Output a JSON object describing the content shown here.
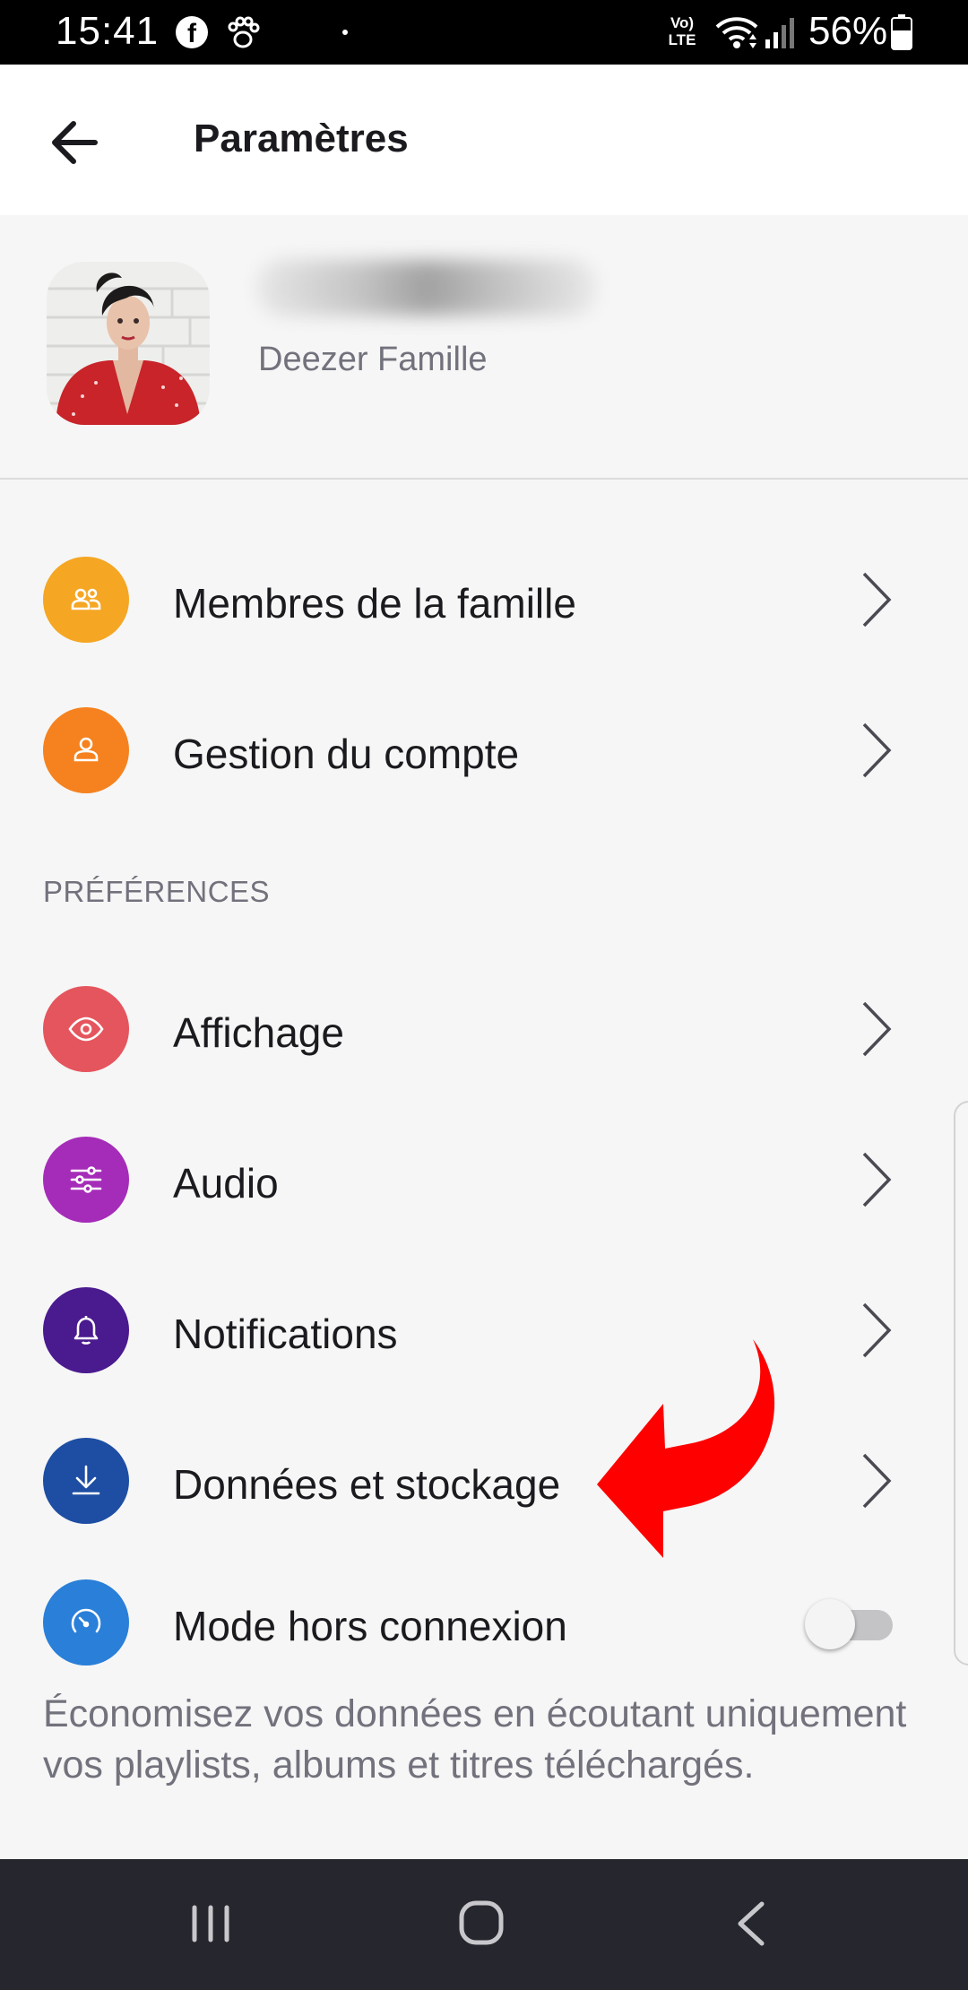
{
  "status_bar": {
    "time": "15:41",
    "facebook_glyph": "f",
    "volte_line1": "Vo)",
    "volte_line2": "LTE",
    "battery": "56%",
    "icons": [
      "facebook-icon",
      "paw-icon",
      "volte-icon",
      "wifi-icon",
      "signal-icon",
      "battery-icon"
    ]
  },
  "header": {
    "title": "Paramètres",
    "back_icon": "arrow-left-icon"
  },
  "profile": {
    "plan": "Deezer Famille"
  },
  "account_items": [
    {
      "label": "Membres de la famille",
      "icon": "family-icon",
      "color": "#f5a623"
    },
    {
      "label": "Gestion du compte",
      "icon": "user-icon",
      "color": "#f5821f"
    }
  ],
  "preferences": {
    "header": "PRÉFÉRENCES",
    "items": [
      {
        "label": "Affichage",
        "icon": "eye-icon",
        "color": "#e5555d"
      },
      {
        "label": "Audio",
        "icon": "sliders-icon",
        "color": "#a52cb8"
      },
      {
        "label": "Notifications",
        "icon": "bell-icon",
        "color": "#4a1a8f"
      },
      {
        "label": "Données et stockage",
        "icon": "download-icon",
        "color": "#1e4ea3"
      }
    ],
    "offline": {
      "label": "Mode hors connexion",
      "icon": "gauge-icon",
      "color": "#2a7fd8",
      "enabled": false,
      "description": "Économisez vos données en écoutant uniquement vos playlists, albums et titres téléchargés."
    }
  },
  "annotation": {
    "arrow_color": "#ff0000"
  },
  "nav_bar": {
    "icons": [
      "recent-apps-icon",
      "home-icon",
      "back-icon"
    ]
  }
}
